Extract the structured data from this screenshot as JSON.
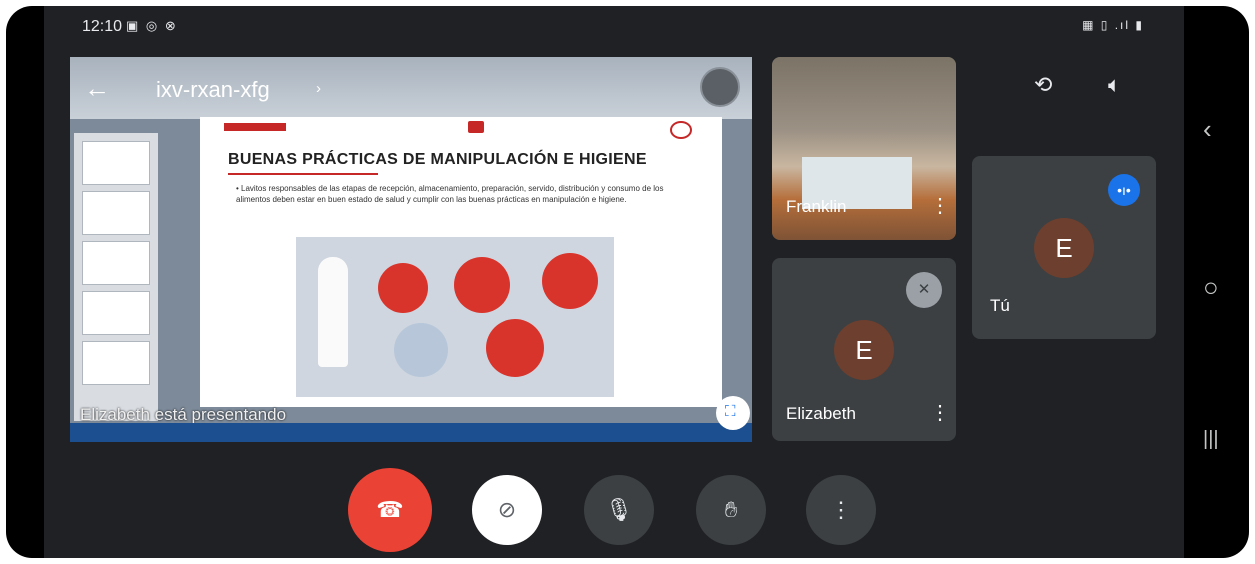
{
  "status": {
    "time": "12:10",
    "left_icons": "▣ ◎ ⊗",
    "right_icons": "▦ ▯ .ıl ▮"
  },
  "presentation": {
    "meeting_code": "ixv-rxan-xfg",
    "slide_title": "BUENAS PRÁCTICAS DE MANIPULACIÓN E HIGIENE",
    "slide_text": "• Lavitos responsables de las etapas de recepción, almacenamiento, preparación, servido, distribución y consumo de los alimentos deben estar en buen estado de salud y cumplir con las buenas prácticas en manipulación e higiene.",
    "presenter_banner": "Elizabeth está presentando",
    "chevron": "›"
  },
  "participants": {
    "franklin": {
      "name": "Franklin"
    },
    "elizabeth": {
      "name": "Elizabeth",
      "initial": "E"
    },
    "you": {
      "name": "Tú",
      "initial": "E"
    }
  },
  "icons": {
    "back": "←",
    "rotate_camera": "⟲",
    "speaker": "🔈︎",
    "menu": "⋮",
    "fullscreen": "⛶",
    "mic_muted": "✕",
    "speaking": "•ı•",
    "end_call": "☎",
    "camera_off": "⊘",
    "mic": "🎙︎",
    "hand": "✋︎",
    "more": "⋮",
    "nav_back": "‹",
    "nav_home": "○",
    "nav_recent": "|||"
  },
  "colors": {
    "end_call": "#ea4335",
    "accent_blue": "#1a73e8",
    "tile": "#3c4043",
    "avatar": "#6d3f2e"
  }
}
